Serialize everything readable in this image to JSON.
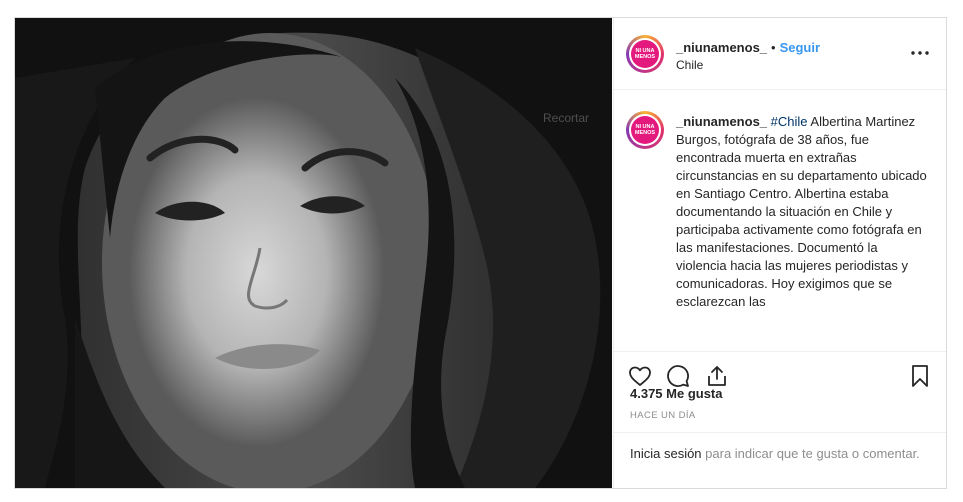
{
  "post": {
    "username": "_niunamenos_",
    "separator": "•",
    "follow_label": "Seguir",
    "location": "Chile",
    "avatar_text": "NI UNA MENOS"
  },
  "caption": {
    "username": "_niunamenos_",
    "hashtag": "#Chile",
    "text": " Albertina Martinez Burgos, fotógrafa de 38 años, fue encontrada muerta en extrañas circunstancias en su departamento ubicado en Santiago Centro. Albertina estaba documentando la situación en Chile y participaba activamente como fotógrafa en las manifestaciones. Documentó la violencia hacia las mujeres periodistas y comunicadoras. Hoy exigimos que se esclarezcan las"
  },
  "actions": {
    "like_icon": "heart-icon",
    "comment_icon": "comment-icon",
    "share_icon": "share-icon",
    "save_icon": "bookmark-icon"
  },
  "likes": "4.375 Me gusta",
  "timestamp": "HACE UN DÍA",
  "login": {
    "link_label": "Inicia sesión",
    "text": " para indicar que te gusta o comentar."
  },
  "colors": {
    "link_blue": "#3897f0",
    "hashtag": "#003569",
    "logo_pink": "#e4197d"
  }
}
